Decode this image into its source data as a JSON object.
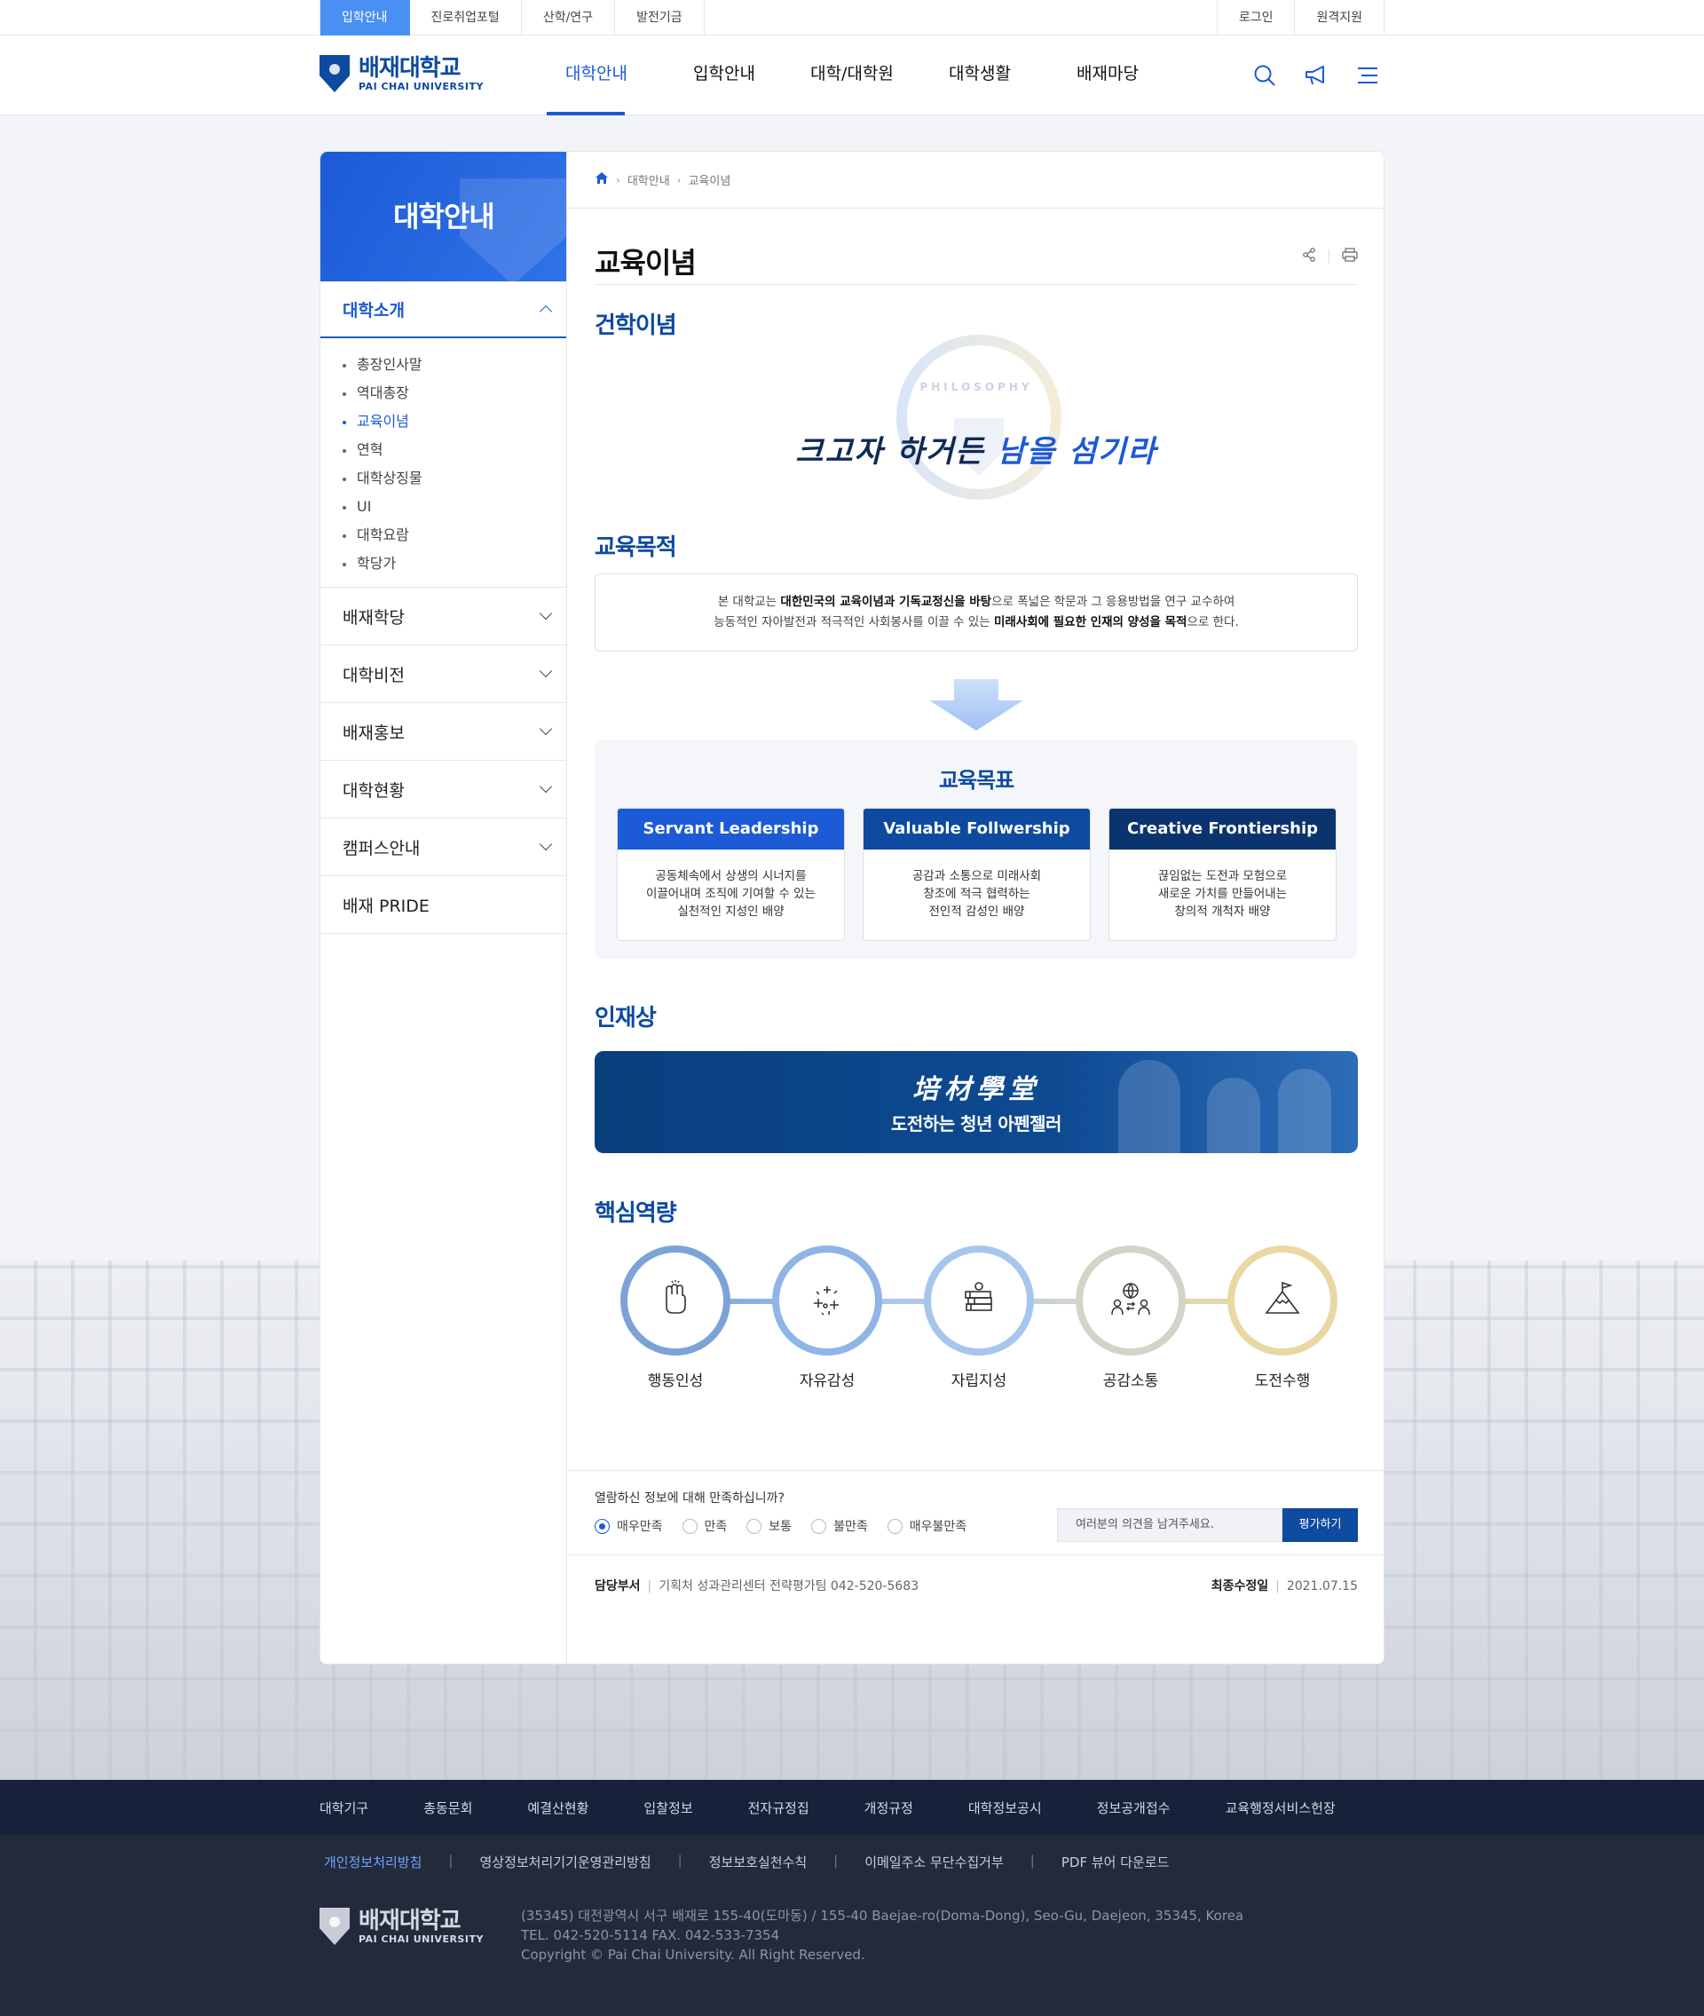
{
  "top_util": {
    "left": [
      "입학안내",
      "진로취업포털",
      "산학/연구",
      "발전기금"
    ],
    "right": [
      "로그인",
      "원격지원"
    ]
  },
  "logo": {
    "ko": "배재대학교",
    "en": "PAI CHAI UNIVERSITY"
  },
  "gnb": [
    "대학안내",
    "입학안내",
    "대학/대학원",
    "대학생활",
    "배재마당"
  ],
  "lnb": {
    "title": "대학안내",
    "open_group": "대학소개",
    "sub_items": [
      "총장인사말",
      "역대총장",
      "교육이념",
      "연혁",
      "대학상징물",
      "UI",
      "대학요람",
      "학당가"
    ],
    "groups": [
      "배재학당",
      "대학비전",
      "배재홍보",
      "대학현황",
      "캠퍼스안내",
      "배재 PRIDE"
    ]
  },
  "breadcrumb": [
    "대학안내",
    "교육이념"
  ],
  "page_title": "교육이념",
  "philosophy": {
    "section": "건학이념",
    "label": "PHILOSOPHY",
    "motto_a": "크고자 하거든 ",
    "motto_b": "남을 섬기라"
  },
  "purpose": {
    "section": "교육목적",
    "l1_a": "본 대학교는 ",
    "l1_b": "대한민국의 교육이념과 기독교정신을 바탕",
    "l1_c": "으로 폭넓은 학문과 그 응용방법을 연구 교수하여",
    "l2_a": "능동적인 자아발전과 적극적인 사회봉사를 이끌 수 있는 ",
    "l2_b": "미래사회에 필요한 인재의 양성을 목적",
    "l2_c": "으로 한다."
  },
  "goals": {
    "title": "교육목표",
    "cards": [
      {
        "head": "Servant Leadership",
        "body": "공동체속에서 상생의 시너지를\n이끌어내며 조직에 기여할 수 있는\n실천적인 지성인 배양",
        "color": "#1c5ad6"
      },
      {
        "head": "Valuable Follwership",
        "body": "공감과 소통으로 미래사회\n창조에 적극 협력하는\n전인적 감성인 배양",
        "color": "#0d4aa0"
      },
      {
        "head": "Creative Frontiership",
        "body": "끊임없는 도전과 모험으로\n새로운 가치를 만들어내는\n창의적 개척자 배양",
        "color": "#0b336e"
      }
    ]
  },
  "talent": {
    "section": "인재상",
    "hanja": "培材學堂",
    "slogan": "도전하는 청년 아펜젤러"
  },
  "competency": {
    "section": "핵심역량",
    "items": [
      {
        "label": "행동인성",
        "icon": "fist-icon",
        "color": "#7ca3d6"
      },
      {
        "label": "자유감성",
        "icon": "sparkle-icon",
        "color": "#8fb4e6"
      },
      {
        "label": "자립지성",
        "icon": "books-icon",
        "color": "#a7c6ee"
      },
      {
        "label": "공감소통",
        "icon": "globe-people-icon",
        "color": "#cfd6c8"
      },
      {
        "label": "도전수행",
        "icon": "mountain-flag-icon",
        "color": "#ead8a3"
      }
    ]
  },
  "survey": {
    "question": "열람하신 정보에 대해 만족하십니까?",
    "options": [
      "매우만족",
      "만족",
      "보통",
      "불만족",
      "매우불만족"
    ],
    "selected": "매우만족",
    "placeholder": "여러분의 의견을 남겨주세요.",
    "button": "평가하기"
  },
  "manager": {
    "dept_label": "담당부서",
    "dept": "기획처 성과관리센터 전략평가팀 042-520-5683",
    "updated_label": "최종수정일",
    "updated": "2021.07.15"
  },
  "footer_links": [
    "대학기구",
    "총동문회",
    "예결산현황",
    "입찰정보",
    "전자규정집",
    "개정규정",
    "대학정보공시",
    "정보공개접수",
    "교육행정서비스헌장"
  ],
  "policy_links": [
    "개인정보처리방침",
    "영상정보처리기기운영관리방침",
    "정보보호실천수칙",
    "이메일주소 무단수집거부",
    "PDF 뷰어 다운로드"
  ],
  "address": {
    "line1": "(35345) 대전광역시 서구 배재로 155-40(도마동) / 155-40 Baejae-ro(Doma-Dong), Seo-Gu, Daejeon, 35345, Korea",
    "line2": "TEL. 042-520-5114 FAX. 042-533-7354",
    "line3": "Copyright © Pai Chai University. All Right Reserved."
  },
  "colors": {
    "primary": "#1c5ad6",
    "navy": "#0d4aa0",
    "footer": "#222a3b"
  }
}
